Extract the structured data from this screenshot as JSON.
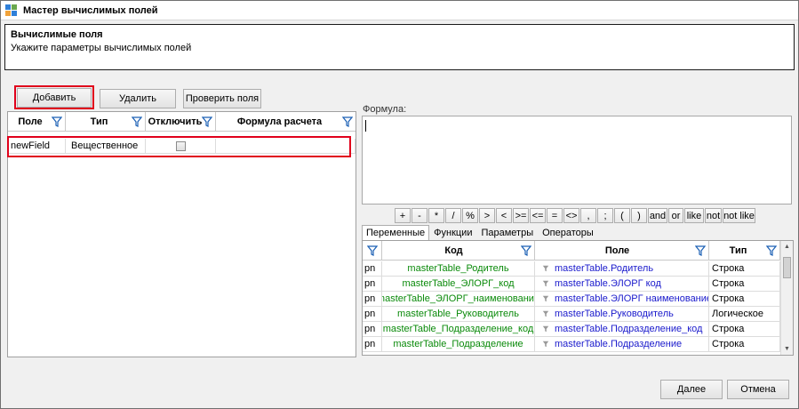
{
  "window": {
    "title": "Мастер вычислимых полей"
  },
  "header": {
    "title": "Вычислимые поля",
    "subtitle": "Укажите параметры вычислимых полей"
  },
  "toolbar": {
    "add_label": "Добавить",
    "delete_label": "Удалить",
    "check_label": "Проверить поля"
  },
  "fields_grid": {
    "columns": [
      "Поле",
      "Тип",
      "Отключить",
      "Формула расчета"
    ],
    "rows": [
      {
        "field": "newField",
        "type": "Вещественное",
        "disabled": false,
        "formula": ""
      }
    ]
  },
  "formula": {
    "label": "Формула:",
    "value": ""
  },
  "operators": [
    "+",
    "-",
    "*",
    "/",
    "%",
    ">",
    "<",
    ">=",
    "<=",
    "=",
    "<>",
    ",",
    ";",
    "(",
    ")",
    "and",
    "or",
    "like",
    "not",
    "not like"
  ],
  "tabs": [
    "Переменные",
    "Функции",
    "Параметры",
    "Операторы"
  ],
  "variables_grid": {
    "columns": [
      "Код",
      "Поле",
      "Тип"
    ],
    "rows": [
      {
        "prefix": "pn",
        "code": "masterTable_Родитель",
        "field": "masterTable.Родитель",
        "type": "Строка"
      },
      {
        "prefix": "pn",
        "code": "masterTable_ЭЛОРГ_код",
        "field": "masterTable.ЭЛОРГ код",
        "type": "Строка"
      },
      {
        "prefix": "pn",
        "code": "masterTable_ЭЛОРГ_наименование",
        "field": "masterTable.ЭЛОРГ наименование",
        "type": "Строка"
      },
      {
        "prefix": "pn",
        "code": "masterTable_Руководитель",
        "field": "masterTable.Руководитель",
        "type": "Логическое"
      },
      {
        "prefix": "pn",
        "code": "masterTable_Подразделение_код",
        "field": "masterTable.Подразделение_код",
        "type": "Строка"
      },
      {
        "prefix": "pn",
        "code": "masterTable_Подразделение",
        "field": "masterTable.Подразделение",
        "type": "Строка"
      }
    ]
  },
  "footer": {
    "next_label": "Далее",
    "cancel_label": "Отмена"
  },
  "colors": {
    "highlight": "#e0001b",
    "code_text": "#0a8a0a",
    "field_text": "#1a1acc",
    "filter_icon": "#1a5fb4"
  }
}
